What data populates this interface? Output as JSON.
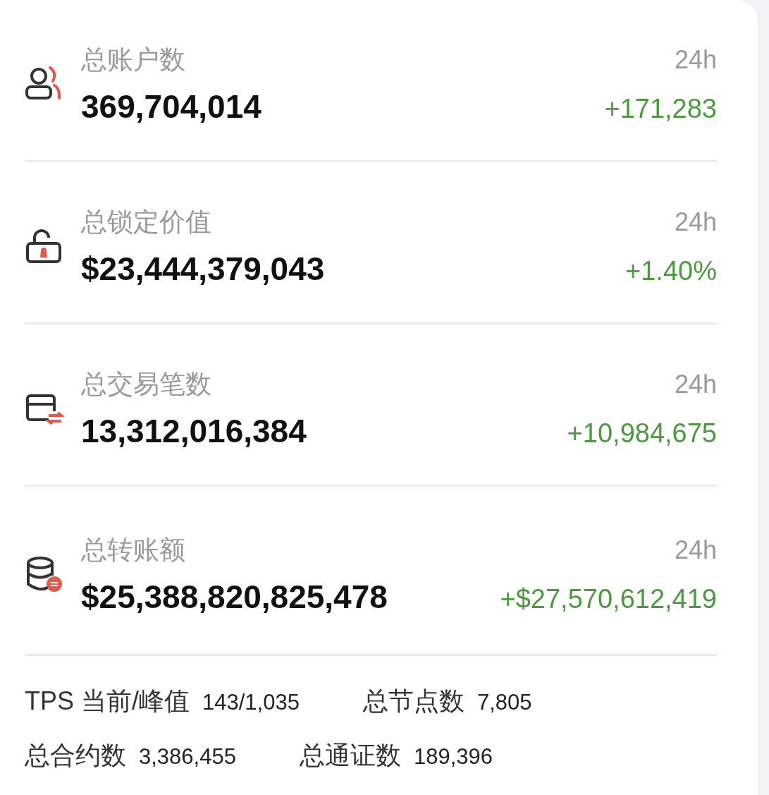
{
  "metrics": [
    {
      "kind": "accounts",
      "label": "总账户数",
      "value": "369,704,014",
      "period": "24h",
      "change": "+171,283"
    },
    {
      "kind": "lock",
      "label": "总锁定价值",
      "value": "$23,444,379,043",
      "period": "24h",
      "change": "+1.40%"
    },
    {
      "kind": "transactions",
      "label": "总交易笔数",
      "value": "13,312,016,384",
      "period": "24h",
      "change": "+10,984,675"
    },
    {
      "kind": "transfers",
      "label": "总转账额",
      "value": "$25,388,820,825,478",
      "period": "24h",
      "change": "+$27,570,612,419"
    }
  ],
  "stats": [
    [
      {
        "label": "TPS 当前/峰值",
        "value": "143/1,035"
      },
      {
        "label": "总节点数",
        "value": "7,805"
      }
    ],
    [
      {
        "label": "总合约数",
        "value": "3,386,455"
      },
      {
        "label": "总通证数",
        "value": "189,396"
      }
    ]
  ]
}
